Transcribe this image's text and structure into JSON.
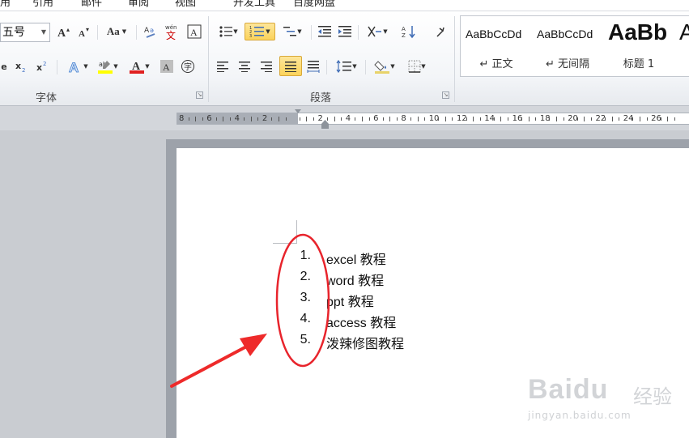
{
  "menu": {
    "items": [
      "引用",
      "邮件",
      "审阅",
      "视图",
      "开发工具",
      "百度网盘"
    ],
    "first_partial": "用"
  },
  "ribbon": {
    "font_group": {
      "label": "字体",
      "font_size_value": "五号",
      "change_case_label": "Aa",
      "phonetic_label": "wén"
    },
    "paragraph_group": {
      "label": "段落"
    },
    "styles": [
      {
        "sample": "AaBbCcDd",
        "name": "↵ 正文"
      },
      {
        "sample": "AaBbCcDd",
        "name": "↵ 无间隔"
      },
      {
        "sample": "AaBb",
        "name": "标题 1"
      },
      {
        "sample": "A",
        "name": ""
      }
    ],
    "colors": {
      "highlight": "#ffff00",
      "font_color": "#e02020",
      "active_btn": "#fbd35b"
    }
  },
  "ruler": {
    "labels": [
      "8",
      "6",
      "4",
      "2",
      "",
      "2",
      "4",
      "6",
      "8",
      "10",
      "12",
      "14",
      "16",
      "18",
      "20",
      "22",
      "24",
      "26"
    ]
  },
  "document": {
    "list": [
      {
        "num": "1.",
        "text": "excel 教程"
      },
      {
        "num": "2.",
        "text": "word 教程"
      },
      {
        "num": "3.",
        "text": "ppt 教程"
      },
      {
        "num": "4.",
        "text": "access 教程"
      },
      {
        "num": "5.",
        "text": "泼辣修图教程"
      }
    ]
  },
  "watermark": {
    "logo": "Baidu",
    "cn": "经验",
    "url": "jingyan.baidu.com"
  }
}
